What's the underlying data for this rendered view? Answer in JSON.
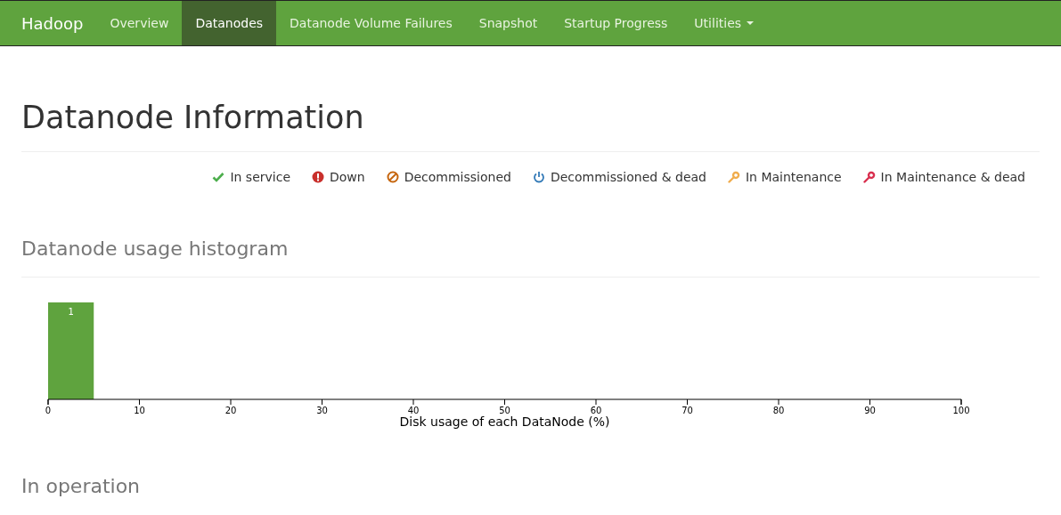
{
  "navbar": {
    "brand": "Hadoop",
    "items": [
      {
        "label": "Overview",
        "selected": false,
        "dropdown": false
      },
      {
        "label": "Datanodes",
        "selected": true,
        "dropdown": false
      },
      {
        "label": "Datanode Volume Failures",
        "selected": false,
        "dropdown": false
      },
      {
        "label": "Snapshot",
        "selected": false,
        "dropdown": false
      },
      {
        "label": "Startup Progress",
        "selected": false,
        "dropdown": false
      },
      {
        "label": "Utilities",
        "selected": false,
        "dropdown": true
      }
    ]
  },
  "page_title": "Datanode Information",
  "legend": [
    {
      "kind": "check",
      "label": "In service",
      "color": "#4cae4c"
    },
    {
      "kind": "exclamation",
      "label": "Down",
      "color": "#c9302c"
    },
    {
      "kind": "ban",
      "label": "Decommissioned",
      "color": "#c6660f"
    },
    {
      "kind": "power",
      "label": "Decommissioned & dead",
      "color": "#337ab7"
    },
    {
      "kind": "wrench",
      "label": "In Maintenance",
      "color": "#f0ad4e"
    },
    {
      "kind": "wrench",
      "label": "In Maintenance & dead",
      "color": "#d9304f"
    }
  ],
  "histogram": {
    "heading": "Datanode usage histogram",
    "chart_data": {
      "type": "bar",
      "xlabel": "Disk usage of each DataNode (%)",
      "x": [
        2.5
      ],
      "values": [
        1
      ],
      "data_labels": true,
      "xlim": [
        0,
        100
      ],
      "xticks": [
        {
          "value": 0,
          "label": "0"
        },
        {
          "value": 10,
          "label": "10"
        },
        {
          "value": 20,
          "label": "20"
        },
        {
          "value": 30,
          "label": "30"
        },
        {
          "value": 40,
          "label": "40"
        },
        {
          "value": 50,
          "label": "50"
        },
        {
          "value": 60,
          "label": "60"
        },
        {
          "value": 70,
          "label": "70"
        },
        {
          "value": 80,
          "label": "80"
        },
        {
          "value": 90,
          "label": "90"
        },
        {
          "value": 100,
          "label": "100"
        }
      ]
    }
  },
  "section_heading": "In operation"
}
